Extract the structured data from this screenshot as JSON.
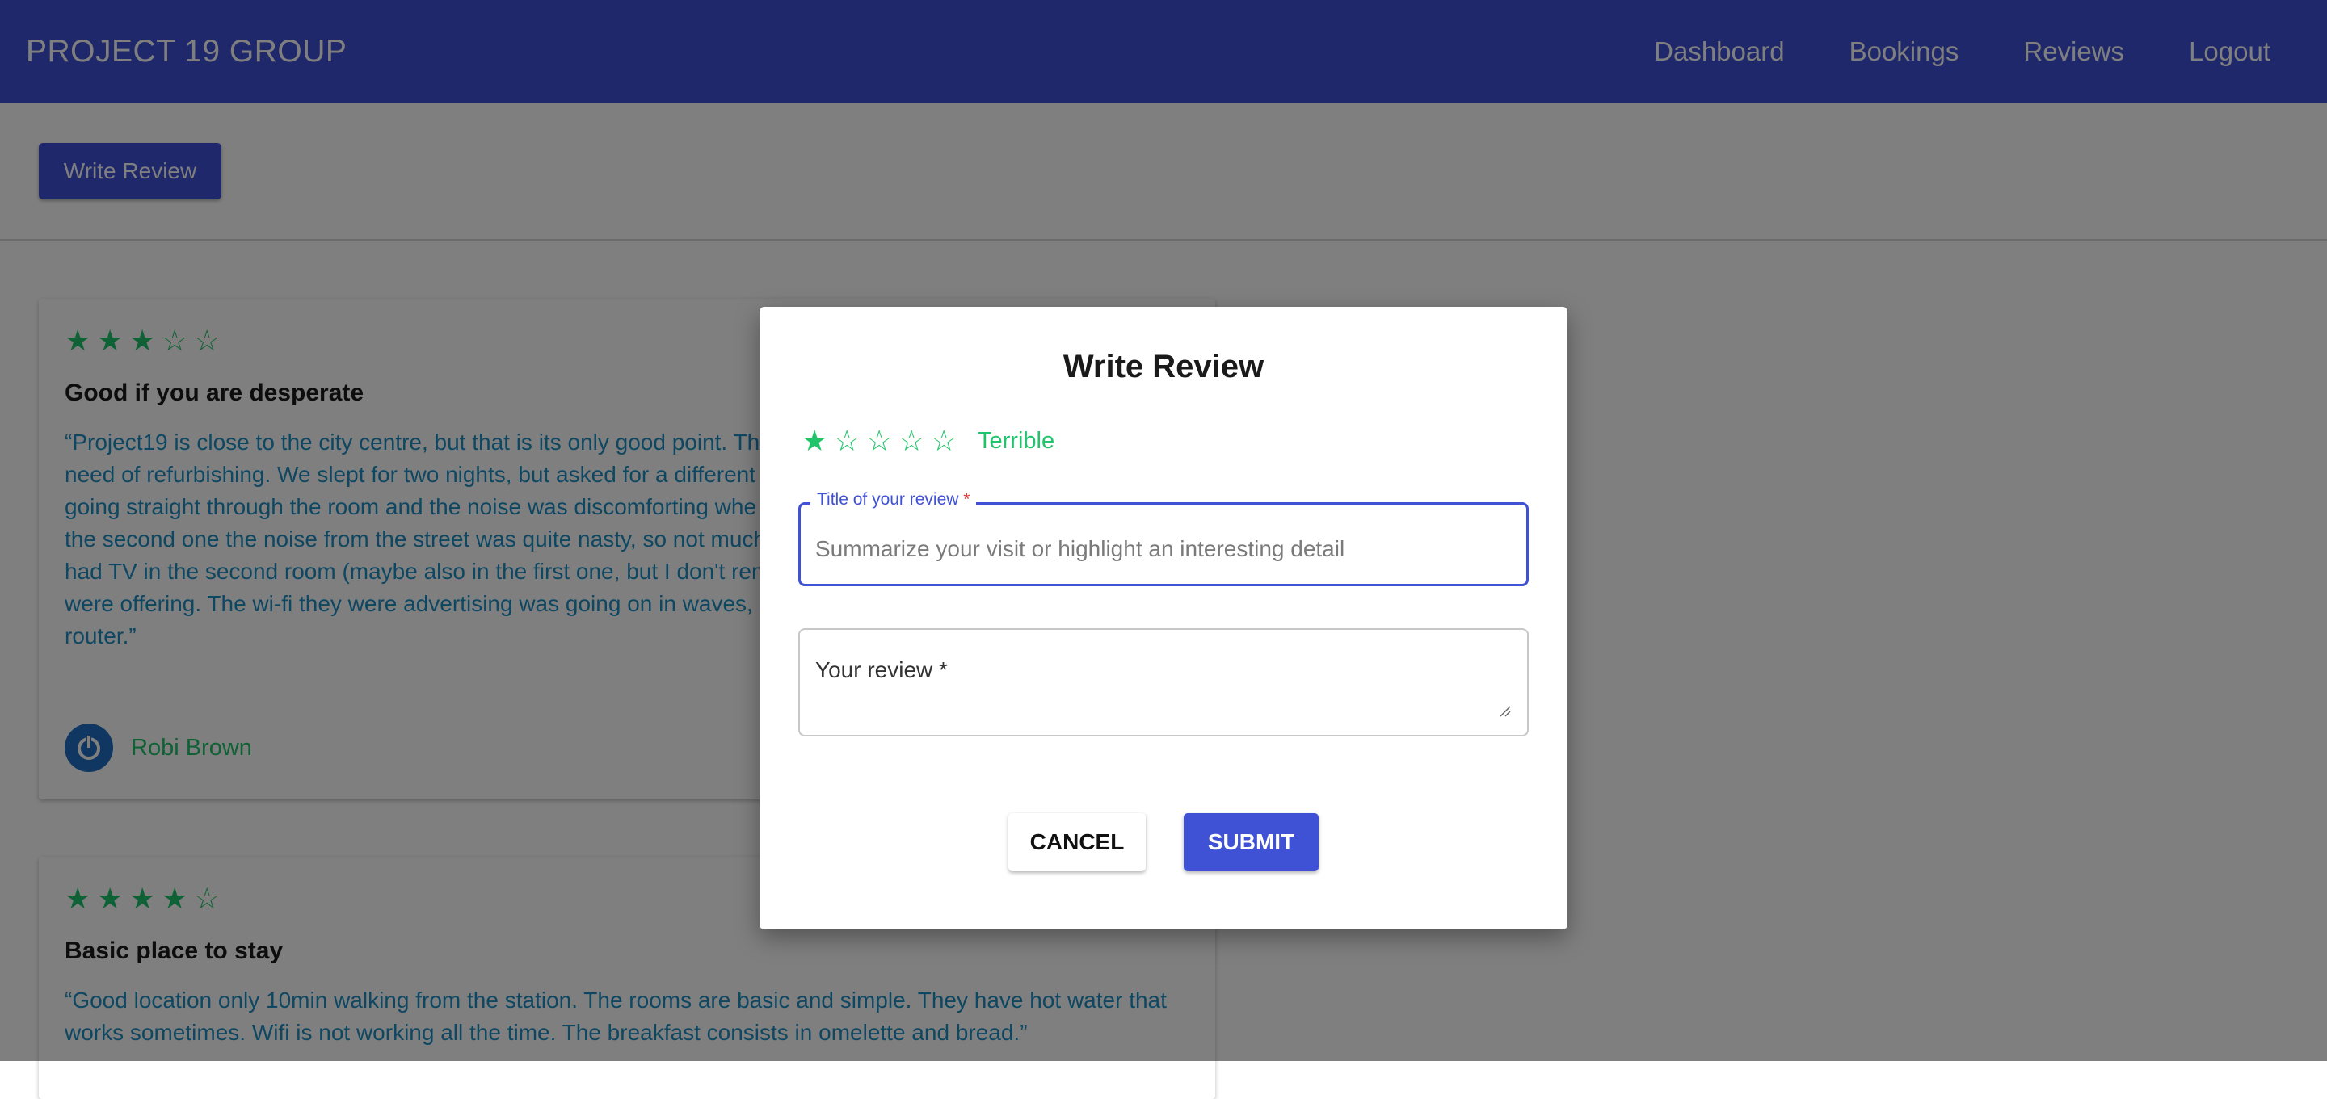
{
  "header": {
    "brand": "PROJECT 19 GROUP",
    "nav": [
      "Dashboard",
      "Bookings",
      "Reviews",
      "Logout"
    ]
  },
  "toolbar": {
    "write_review_label": "Write Review"
  },
  "reviews": [
    {
      "rating": 3,
      "title": "Good if you are desperate",
      "body": "“Project19 is close to the city centre, but that is its only good point. Th… need of refurbishing. We slept for two nights, but asked for a different… going straight through the room and the noise was discomforting whe… the second one the noise from the street was quite nasty, so not much… had TV in the second room (maybe also in the first one, but I don't rem… were offering. The wi-fi they were advertising was going on in waves, a… router.”",
      "body_lines": [
        "“Project19 is close to the city centre, but that is its only good point. Th",
        "need of refurbishing. We slept for two nights, but asked for a different",
        "going straight through the room and the noise was discomforting whe",
        "the second one the noise from the street was quite nasty, so not much",
        "had TV in the second room (maybe also in the first one, but I don't rem",
        "were offering. The wi-fi they were advertising was going on in waves, a",
        "router.”"
      ],
      "author": "Robi Brown"
    },
    {
      "rating": 4,
      "title": "Basic place to stay",
      "body_lines": [
        "“Good location only 10min walking from the station. The rooms are basic and simple. They have hot water that",
        "works sometimes. Wifi is not working all the time. The breakfast consists in omelette and bread.”"
      ]
    }
  ],
  "modal": {
    "title": "Write Review",
    "rating": 1,
    "rating_label": "Terrible",
    "title_field": {
      "label": "Title of your review",
      "required_mark": "*",
      "placeholder": "Summarize your visit or highlight an interesting detail",
      "value": ""
    },
    "review_field": {
      "placeholder": "Your review *",
      "value": ""
    },
    "cancel_label": "CANCEL",
    "submit_label": "SUBMIT"
  },
  "colors": {
    "primary": "#3f51d5",
    "accent_green": "#1fc46b",
    "review_text": "#1d8fc4",
    "required": "#e53935"
  },
  "icons": {
    "star_filled": "star-filled-icon",
    "star_empty": "star-outline-icon",
    "avatar": "power-icon"
  }
}
